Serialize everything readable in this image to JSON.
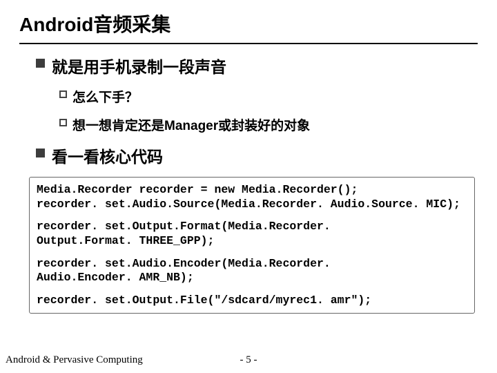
{
  "title": "Android音频采集",
  "bullets": {
    "b1": "就是用手机录制一段声音",
    "b1a": "怎么下手？",
    "b1b": "想一想肯定还是Manager或封装好的对象",
    "b2": "看一看核心代码"
  },
  "code": {
    "line1": "Media.Recorder recorder = new Media.Recorder();",
    "line2": "recorder. set.Audio.Source(Media.Recorder. Audio.Source. MIC);",
    "line3": "recorder. set.Output.Format(Media.Recorder.",
    "line4": "Output.Format. THREE_GPP);",
    "line5": "recorder. set.Audio.Encoder(Media.Recorder.",
    "line6": "Audio.Encoder. AMR_NB);",
    "line7": "recorder. set.Output.File(\"/sdcard/myrec1. amr\");"
  },
  "footer": {
    "left": "Android & Pervasive Computing",
    "page": "- 5 -"
  }
}
